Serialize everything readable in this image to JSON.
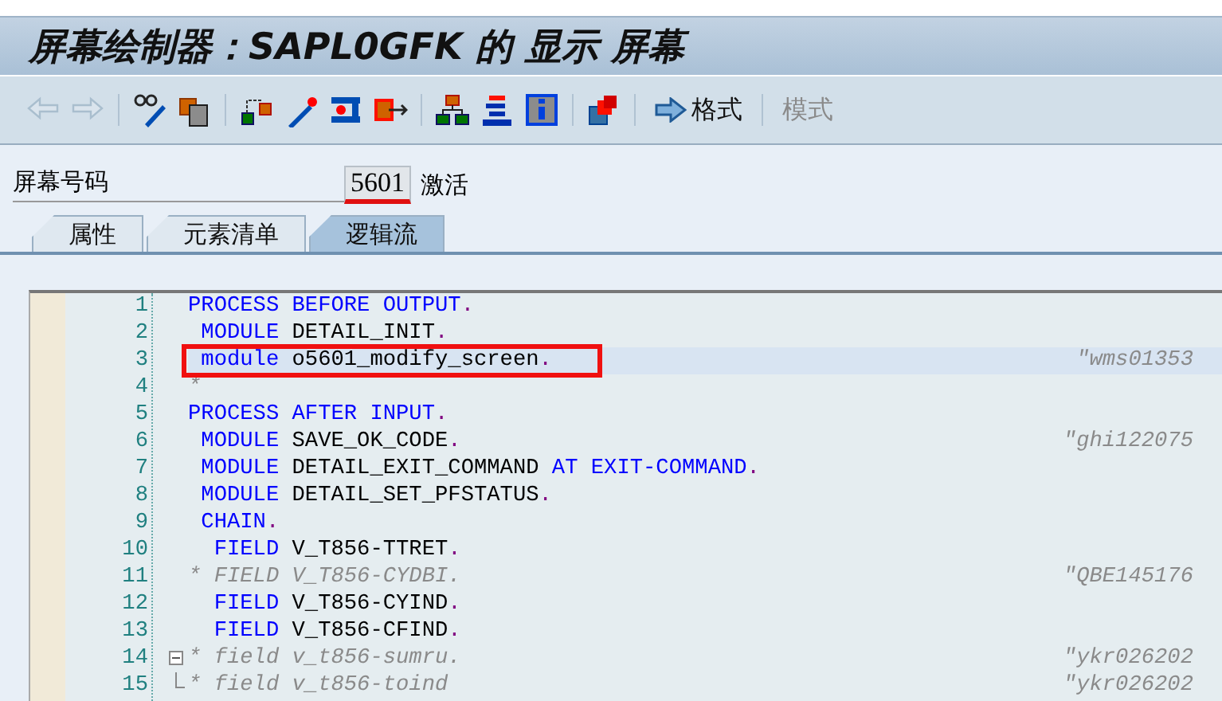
{
  "window": {
    "title": "屏幕绘制器：SAPL0GFK 的 显示 屏幕"
  },
  "toolbar": [
    {
      "kind": "back",
      "disabled": true
    },
    {
      "kind": "forward",
      "disabled": true
    },
    {
      "kind": "separator"
    },
    {
      "kind": "glasses"
    },
    {
      "kind": "document"
    },
    {
      "kind": "separator"
    },
    {
      "kind": "connector"
    },
    {
      "kind": "wand"
    },
    {
      "kind": "clamp"
    },
    {
      "kind": "export"
    },
    {
      "kind": "separator"
    },
    {
      "kind": "hierarchy"
    },
    {
      "kind": "stack"
    },
    {
      "kind": "info"
    },
    {
      "kind": "separator"
    },
    {
      "kind": "layers"
    },
    {
      "kind": "separator"
    },
    {
      "kind": "text",
      "label": "格式",
      "disabled": false
    },
    {
      "kind": "separator"
    },
    {
      "kind": "text",
      "label": "模式",
      "disabled": true
    }
  ],
  "screen_number": {
    "label": "屏幕号码",
    "value": "5601",
    "status": "激活"
  },
  "tabs": [
    {
      "label": "属性",
      "selected": false
    },
    {
      "label": "元素清单",
      "selected": false
    },
    {
      "label": "逻辑流",
      "selected": true
    }
  ],
  "editor": {
    "lines": [
      {
        "number": "1",
        "selected": false,
        "tokens": [
          {
            "kind": "keyword",
            "text": "PROCESS BEFORE OUTPUT"
          },
          {
            "kind": "period",
            "text": "."
          }
        ]
      },
      {
        "number": "2",
        "selected": false,
        "tokens": [
          {
            "kind": "keyword",
            "text": " MODULE"
          },
          {
            "kind": "ident",
            "text": " DETAIL_INIT"
          },
          {
            "kind": "period",
            "text": "."
          }
        ]
      },
      {
        "number": "3",
        "selected": true,
        "boxed": true,
        "tokens": [
          {
            "kind": "keyword",
            "text": " module"
          },
          {
            "kind": "ident",
            "text": " o5601_modify_screen"
          },
          {
            "kind": "period",
            "text": "."
          }
        ],
        "note": "\"wms01353"
      },
      {
        "number": "4",
        "selected": false,
        "tokens": [
          {
            "kind": "comment",
            "text": "*"
          }
        ]
      },
      {
        "number": "5",
        "selected": false,
        "tokens": [
          {
            "kind": "keyword",
            "text": "PROCESS AFTER INPUT"
          },
          {
            "kind": "period",
            "text": "."
          }
        ]
      },
      {
        "number": "6",
        "selected": false,
        "tokens": [
          {
            "kind": "keyword",
            "text": " MODULE"
          },
          {
            "kind": "ident",
            "text": " SAVE_OK_CODE"
          },
          {
            "kind": "period",
            "text": "."
          }
        ],
        "note": "\"ghi122075"
      },
      {
        "number": "7",
        "selected": false,
        "tokens": [
          {
            "kind": "keyword",
            "text": " MODULE"
          },
          {
            "kind": "ident",
            "text": " DETAIL_EXIT_COMMAND "
          },
          {
            "kind": "keyword",
            "text": "AT EXIT-COMMAND"
          },
          {
            "kind": "period",
            "text": "."
          }
        ]
      },
      {
        "number": "8",
        "selected": false,
        "tokens": [
          {
            "kind": "keyword",
            "text": " MODULE"
          },
          {
            "kind": "ident",
            "text": " DETAIL_SET_PFSTATUS"
          },
          {
            "kind": "period",
            "text": "."
          }
        ]
      },
      {
        "number": "9",
        "selected": false,
        "tokens": [
          {
            "kind": "keyword",
            "text": " CHAIN"
          },
          {
            "kind": "period",
            "text": "."
          }
        ]
      },
      {
        "number": "10",
        "selected": false,
        "tokens": [
          {
            "kind": "keyword",
            "text": "  FIELD"
          },
          {
            "kind": "ident",
            "text": " V_T856-TTRET"
          },
          {
            "kind": "period",
            "text": "."
          }
        ]
      },
      {
        "number": "11",
        "selected": false,
        "tokens": [
          {
            "kind": "comment",
            "text": "* FIELD V_T856-CYDBI."
          }
        ],
        "note": "\"QBE145176"
      },
      {
        "number": "12",
        "selected": false,
        "tokens": [
          {
            "kind": "keyword",
            "text": "  FIELD"
          },
          {
            "kind": "ident",
            "text": " V_T856-CYIND"
          },
          {
            "kind": "period",
            "text": "."
          }
        ]
      },
      {
        "number": "13",
        "selected": false,
        "tokens": [
          {
            "kind": "keyword",
            "text": "  FIELD"
          },
          {
            "kind": "ident",
            "text": " V_T856-CFIND"
          },
          {
            "kind": "period",
            "text": "."
          }
        ]
      },
      {
        "number": "14",
        "selected": false,
        "collapsible": true,
        "tokens": [
          {
            "kind": "comment",
            "text": "* field v_t856-sumru."
          }
        ],
        "note": "\"ykr026202"
      },
      {
        "number": "15",
        "selected": false,
        "fold_end": true,
        "tokens": [
          {
            "kind": "comment",
            "text": "* field v_t856-toind"
          }
        ],
        "note": "\"ykr026202"
      }
    ]
  }
}
